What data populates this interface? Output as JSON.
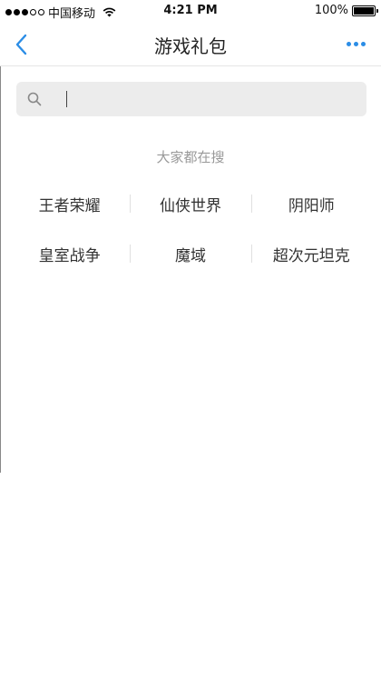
{
  "status_bar": {
    "carrier": "中国移动",
    "time": "4:21 PM",
    "battery": "100%",
    "battery_level": 1.0,
    "signal_bars_filled": 3,
    "signal_bars_total": 5,
    "icons": [
      "signal-icon",
      "wifi-icon",
      "battery-icon"
    ]
  },
  "nav": {
    "title": "游戏礼包",
    "back_icon": "chevron-left-icon",
    "more_icon": "more-dots-icon",
    "accent_color": "#2b8de6"
  },
  "search": {
    "placeholder": "",
    "value": "",
    "icon": "search-icon",
    "background": "#ececec"
  },
  "hot": {
    "title": "大家都在搜",
    "rows": [
      [
        "王者荣耀",
        "仙侠世界",
        "阴阳师"
      ],
      [
        "皇室战争",
        "魔域",
        "超次元坦克"
      ]
    ]
  }
}
